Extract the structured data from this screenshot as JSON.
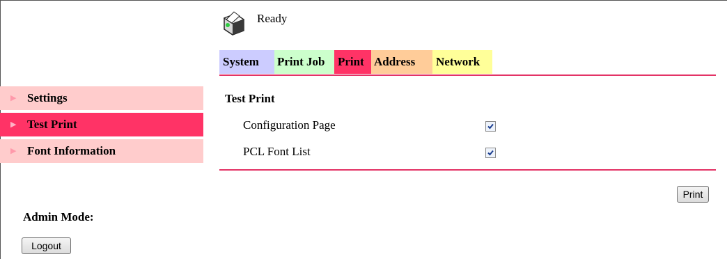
{
  "status": {
    "text": "Ready",
    "icon": "printer-ready-icon"
  },
  "tabs": [
    {
      "label": "System",
      "color": "#ccccff"
    },
    {
      "label": "Print Job",
      "color": "#ccffcc"
    },
    {
      "label": "Print",
      "color": "#ff3366",
      "active": true
    },
    {
      "label": "Address",
      "color": "#ffcc99"
    },
    {
      "label": "Network",
      "color": "#ffff99"
    }
  ],
  "sidebar": {
    "items": [
      {
        "label": "Settings",
        "active": false
      },
      {
        "label": "Test Print",
        "active": true
      },
      {
        "label": "Font Information",
        "active": false
      }
    ]
  },
  "main": {
    "section_title": "Test Print",
    "options": [
      {
        "label": "Configuration Page",
        "checked": true
      },
      {
        "label": "PCL Font List",
        "checked": true
      }
    ],
    "print_button": "Print"
  },
  "admin": {
    "label": "Admin Mode:",
    "logout_button": "Logout"
  },
  "colors": {
    "accent": "#ff3366",
    "rule": "#e33366",
    "sidebar_bg": "#ffcccc"
  }
}
